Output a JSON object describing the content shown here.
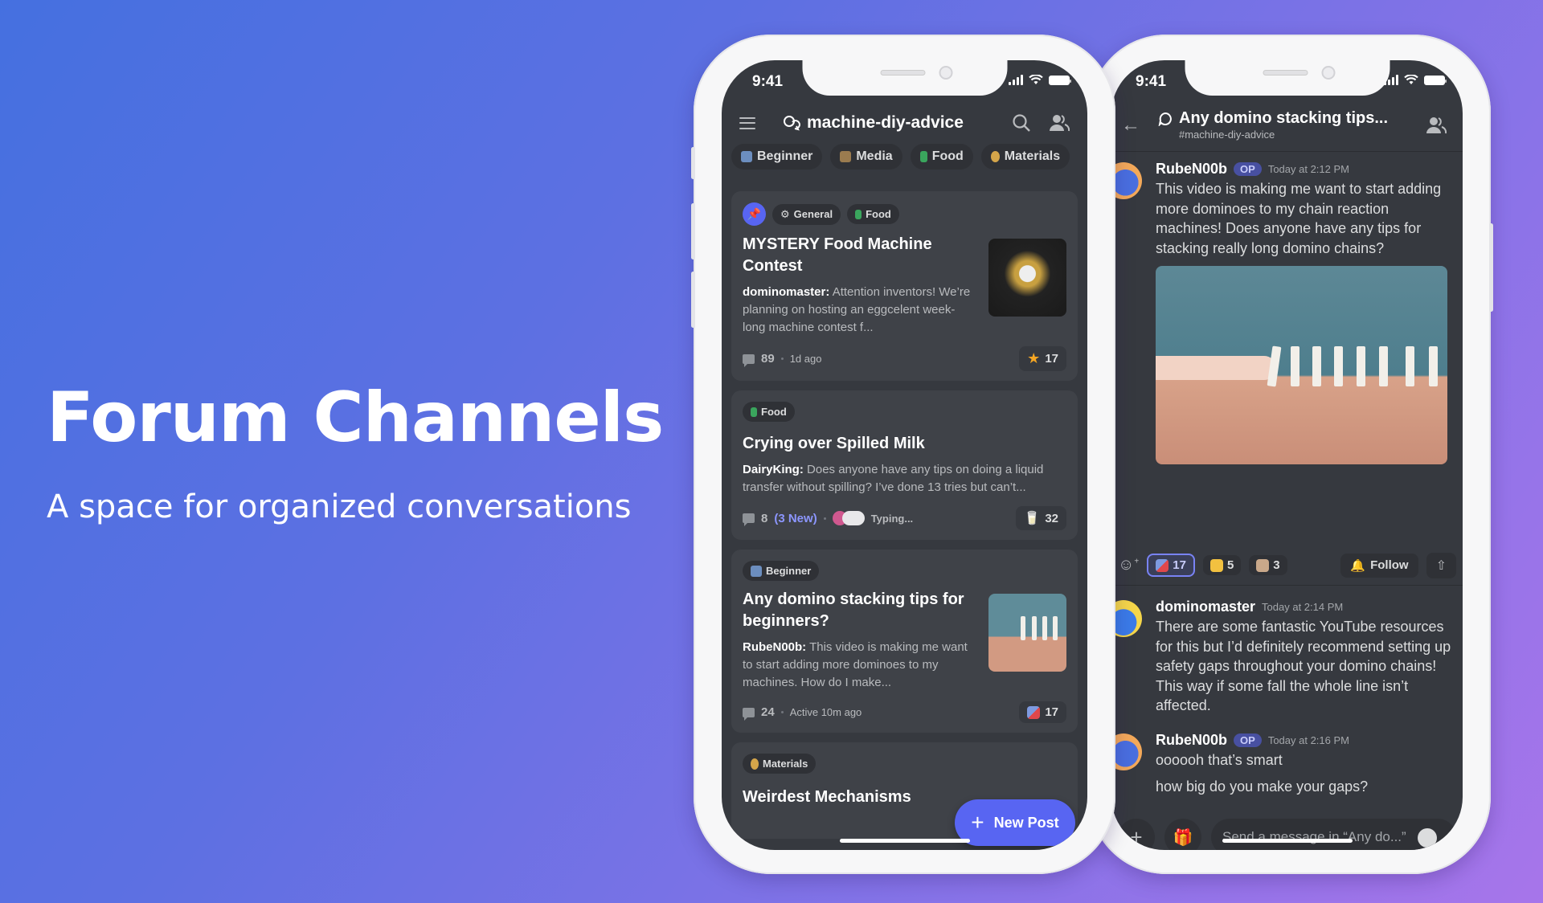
{
  "hero": {
    "title": "Forum Channels",
    "subtitle": "A space for organized conversations"
  },
  "status_bar": {
    "time": "9:41"
  },
  "forum": {
    "channel_name": "machine-diy-advice",
    "tags": [
      {
        "label": "Beginner",
        "icon": "new-badge-icon",
        "color": "#6c8ebf"
      },
      {
        "label": "Media",
        "icon": "camera-icon",
        "color": "#9a7b4f"
      },
      {
        "label": "Food",
        "icon": "milk-carton-icon",
        "color": "#3aa55d"
      },
      {
        "label": "Materials",
        "icon": "money-bag-icon",
        "color": "#d4a54a"
      }
    ],
    "posts": [
      {
        "pinned": true,
        "tags": [
          {
            "label": "General",
            "icon": "gear-icon"
          },
          {
            "label": "Food",
            "icon": "milk-carton-icon"
          }
        ],
        "title": "MYSTERY Food Machine Contest",
        "author": "dominomaster:",
        "excerpt": "Attention inventors! We’re planning on hosting an eggcelent week-long machine contest f...",
        "comments": "89",
        "time": "1d ago",
        "reaction": {
          "icon": "star-icon",
          "count": "17"
        },
        "thumbnail": "eggs-image"
      },
      {
        "pinned": false,
        "tags": [
          {
            "label": "Food",
            "icon": "milk-carton-icon"
          }
        ],
        "title": "Crying over Spilled Milk",
        "author": "DairyKing:",
        "excerpt": "Does anyone have any tips on doing a liquid transfer without spilling? I’ve done 13 tries but can’t...",
        "comments": "8",
        "new_count": "(3 New)",
        "typing": "Typing...",
        "reaction": {
          "icon": "milk-splash-icon",
          "count": "32"
        }
      },
      {
        "pinned": false,
        "tags": [
          {
            "label": "Beginner",
            "icon": "new-badge-icon"
          }
        ],
        "title": "Any domino stacking tips for beginners?",
        "author": "RubeN00b:",
        "excerpt": "This video is making me want to start adding more dominoes to my machines. How do I make...",
        "comments": "24",
        "time": "Active 10m ago",
        "reaction": {
          "icon": "bear-heart-icon",
          "count": "17"
        },
        "thumbnail": "dominoes-image"
      },
      {
        "pinned": false,
        "tags": [
          {
            "label": "Materials",
            "icon": "money-bag-icon"
          }
        ],
        "title": "Weirdest Mechanisms"
      }
    ],
    "new_post_label": "New Post"
  },
  "thread": {
    "title": "Any domino stacking tips...",
    "channel": "#machine-diy-advice",
    "messages": [
      {
        "author": "RubeN00b",
        "op": "OP",
        "time": "Today at 2:12 PM",
        "text": "This video is making me want to start adding more dominoes to my chain reaction machines! Does anyone have any tips for stacking really long domino chains?"
      },
      {
        "author": "dominomaster",
        "time": "Today at 2:14 PM",
        "text": "There are some fantastic YouTube resources for this but I’d definitely recommend setting up safety gaps throughout your domino chains! This way if some fall the whole line isn’t affected."
      },
      {
        "author": "RubeN00b",
        "op": "OP",
        "time": "Today at 2:16 PM",
        "text": "oooooh that’s smart",
        "text2": "how big do you make your gaps?"
      }
    ],
    "reactions": [
      {
        "icon": "bear-heart-icon",
        "count": "17",
        "active": true
      },
      {
        "icon": "cat-icon",
        "count": "5",
        "active": false
      },
      {
        "icon": "dog-icon",
        "count": "3",
        "active": false
      }
    ],
    "follow_label": "Follow",
    "composer_placeholder": "Send a message in “Any do...”"
  },
  "colors": {
    "accent": "#5865f2",
    "screen_bg": "#36393f",
    "card_bg": "#3f4248",
    "chip_bg": "#2f3136",
    "new_text": "#8c96ff"
  }
}
